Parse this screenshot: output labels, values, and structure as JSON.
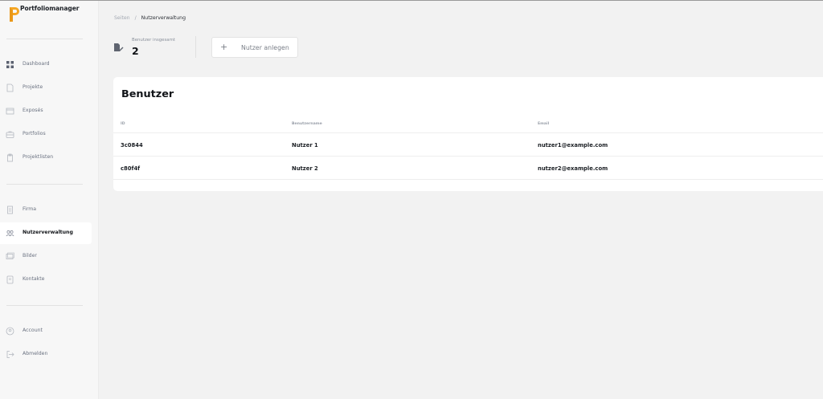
{
  "app": {
    "name": "Portfoliomanager",
    "brand_color": "#f5a623"
  },
  "sidebar": {
    "groups": [
      [
        {
          "label": "Dashboard",
          "icon": "grid-icon"
        },
        {
          "label": "Projekte",
          "icon": "document-icon"
        },
        {
          "label": "Exposés",
          "icon": "window-icon"
        },
        {
          "label": "Portfolios",
          "icon": "briefcase-icon"
        },
        {
          "label": "Projektlisten",
          "icon": "clipboard-icon"
        }
      ],
      [
        {
          "label": "Firma",
          "icon": "building-icon"
        },
        {
          "label": "Nutzerverwaltung",
          "icon": "users-icon",
          "active": true
        },
        {
          "label": "Bilder",
          "icon": "images-icon"
        },
        {
          "label": "Kontakte",
          "icon": "contact-icon"
        }
      ],
      [
        {
          "label": "Account",
          "icon": "user-circle-icon"
        },
        {
          "label": "Abmelden",
          "icon": "logout-icon"
        }
      ]
    ]
  },
  "breadcrumb": {
    "parent": "Seiten",
    "separator": "/",
    "current": "Nutzerverwaltung"
  },
  "stats": {
    "label": "Benutzer insgesamt",
    "value": "2",
    "icon": "user-edit-icon"
  },
  "actions": {
    "add_user_label": "Nutzer anlegen",
    "add_icon": "plus-icon"
  },
  "users_table": {
    "title": "Benutzer",
    "columns": [
      "ID",
      "Benutzername",
      "Email"
    ],
    "rows": [
      [
        "3c0844",
        "Nutzer 1",
        "nutzer1@example.com"
      ],
      [
        "c80f4f",
        "Nutzer 2",
        "nutzer2@example.com"
      ]
    ]
  }
}
